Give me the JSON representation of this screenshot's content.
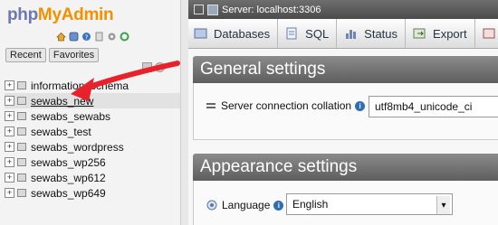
{
  "logo": {
    "part1": "php",
    "part2": "MyAdmin"
  },
  "nav_icons": [
    "home-icon",
    "logout-icon",
    "help-icon",
    "docs-icon",
    "settings-icon",
    "reload-icon"
  ],
  "nav_tabs": {
    "recent": "Recent",
    "favorites": "Favorites"
  },
  "databases": [
    {
      "name": "information_schema",
      "active": false,
      "underline": false
    },
    {
      "name": "sewabs_new",
      "active": true,
      "underline": true
    },
    {
      "name": "sewabs_sewabs",
      "active": false,
      "underline": false
    },
    {
      "name": "sewabs_test",
      "active": false,
      "underline": false
    },
    {
      "name": "sewabs_wordpress",
      "active": false,
      "underline": false
    },
    {
      "name": "sewabs_wp256",
      "active": false,
      "underline": false
    },
    {
      "name": "sewabs_wp612",
      "active": false,
      "underline": false
    },
    {
      "name": "sewabs_wp649",
      "active": false,
      "underline": false
    }
  ],
  "topbar": {
    "server": "Server: localhost:3306"
  },
  "menu": [
    {
      "label": "Databases",
      "icon": "databases-icon"
    },
    {
      "label": "SQL",
      "icon": "sql-icon"
    },
    {
      "label": "Status",
      "icon": "status-icon"
    },
    {
      "label": "Export",
      "icon": "export-icon"
    }
  ],
  "general": {
    "title": "General settings",
    "collation_label": "Server connection collation",
    "collation_value": "utf8mb4_unicode_ci"
  },
  "appearance": {
    "title": "Appearance settings",
    "language_label": "Language",
    "language_value": "English"
  },
  "colors": {
    "arrow": "#e8212a",
    "header": "#6a6a6a",
    "logo_php": "#6c78af",
    "logo_myadmin": "#f29100"
  }
}
